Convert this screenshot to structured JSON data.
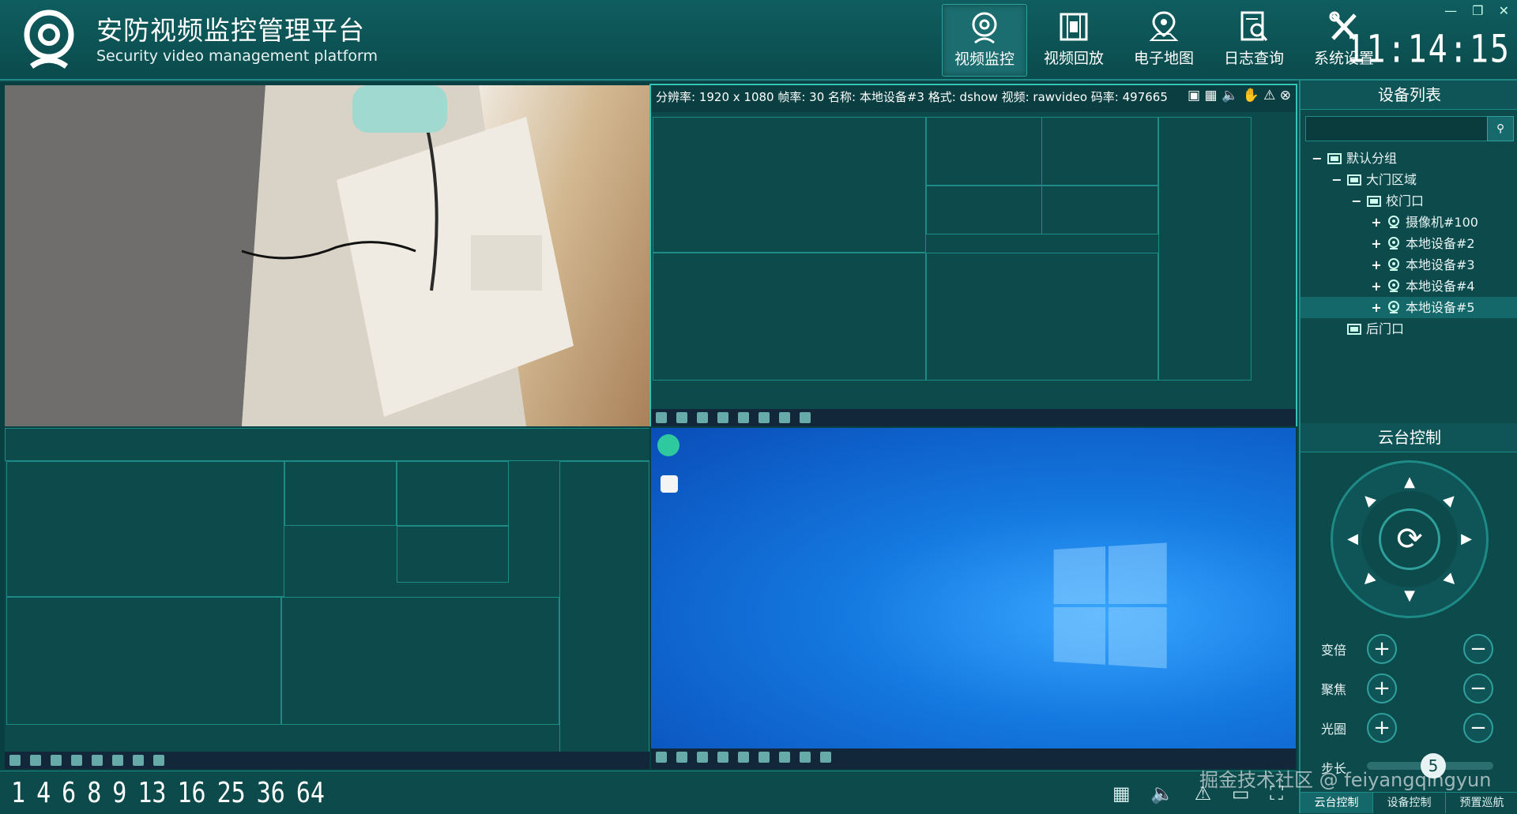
{
  "app": {
    "title": "安防视频监控管理平台",
    "subtitle": "Security video management platform",
    "clock": "11:14:15"
  },
  "nav": [
    {
      "label": "视频监控",
      "icon": "webcam-icon"
    },
    {
      "label": "视频回放",
      "icon": "film-icon"
    },
    {
      "label": "电子地图",
      "icon": "map-pin-icon"
    },
    {
      "label": "日志查询",
      "icon": "log-search-icon"
    },
    {
      "label": "系统设置",
      "icon": "tools-icon"
    }
  ],
  "video": {
    "info": "分辨率: 1920 x 1080  帧率: 30  名称: 本地设备#3  格式: dshow  视频: rawvideo  码率: 497665"
  },
  "splits": [
    "1",
    "4",
    "6",
    "8",
    "9",
    "13",
    "16",
    "25",
    "36",
    "64"
  ],
  "device_panel": {
    "title": "设备列表",
    "tree": [
      {
        "label": "默认分组",
        "toggle": "−",
        "level": 0
      },
      {
        "label": "大门区域",
        "toggle": "−",
        "level": 1
      },
      {
        "label": "校门口",
        "toggle": "−",
        "level": 2
      },
      {
        "label": "摄像机#100",
        "toggle": "+",
        "level": 3
      },
      {
        "label": "本地设备#2",
        "toggle": "+",
        "level": 3
      },
      {
        "label": "本地设备#3",
        "toggle": "+",
        "level": 3
      },
      {
        "label": "本地设备#4",
        "toggle": "+",
        "level": 3
      },
      {
        "label": "本地设备#5",
        "toggle": "+",
        "level": 3
      },
      {
        "label": "后门口",
        "toggle": "",
        "level": 1
      }
    ]
  },
  "ptz": {
    "title": "云台控制",
    "zoom": "变倍",
    "focus": "聚焦",
    "iris": "光圈",
    "step": "步长",
    "step_value": "5",
    "tabs": [
      "云台控制",
      "设备控制",
      "预置巡航"
    ]
  },
  "watermark": "掘金技术社区 @ feiyangqingyun"
}
